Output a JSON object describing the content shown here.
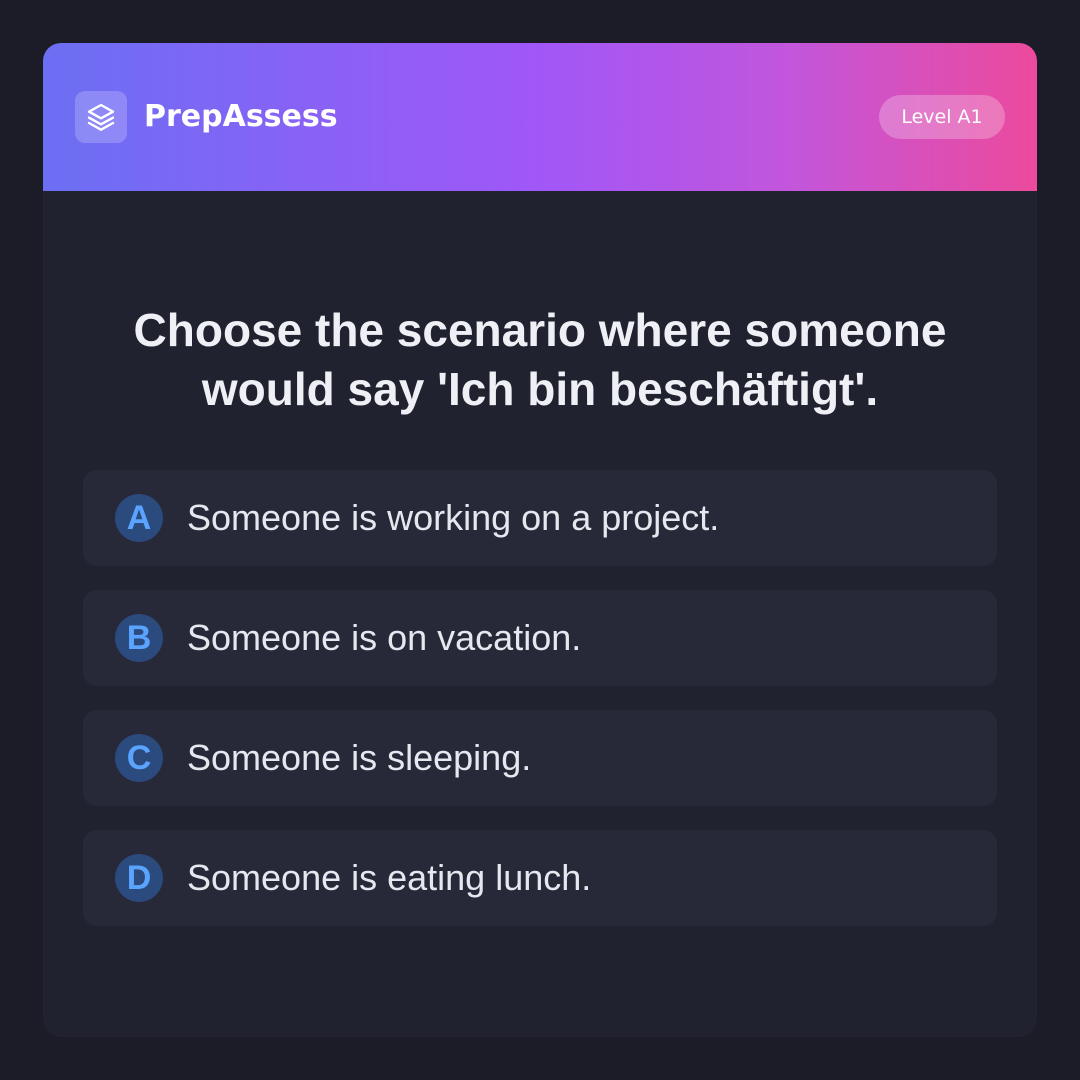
{
  "header": {
    "app_name": "PrepAssess",
    "logo_icon": "layers-icon",
    "level_badge": "Level A1"
  },
  "question": {
    "text": "Choose the scenario where someone would say 'Ich bin beschäftigt'."
  },
  "options": [
    {
      "letter": "A",
      "text": "Someone is working on a project."
    },
    {
      "letter": "B",
      "text": "Someone is on vacation."
    },
    {
      "letter": "C",
      "text": "Someone is sleeping."
    },
    {
      "letter": "D",
      "text": "Someone is eating lunch."
    }
  ],
  "colors": {
    "background": "#1b1c27",
    "card": "#20222f",
    "option_bg": "#272938",
    "accent_blue": "#5aa4ff",
    "gradient_start": "#6b6ff3",
    "gradient_mid": "#a157f7",
    "gradient_end": "#ec4a9c"
  }
}
